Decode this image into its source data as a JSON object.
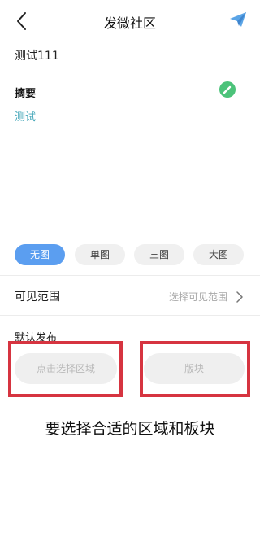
{
  "header": {
    "title": "发微社区",
    "back_icon": "chevron-left-icon",
    "send_icon": "paper-plane-icon",
    "send_color": "#5aa4e6"
  },
  "post": {
    "title": "测试111"
  },
  "summary": {
    "label": "摘要",
    "text": "测试",
    "edit_icon": "pencil-icon",
    "edit_color": "#4cc37a"
  },
  "image_options": {
    "items": [
      {
        "label": "无图",
        "selected": true
      },
      {
        "label": "单图",
        "selected": false
      },
      {
        "label": "三图",
        "selected": false
      },
      {
        "label": "大图",
        "selected": false
      }
    ],
    "active_color": "#5b9ef0"
  },
  "visibility": {
    "label": "可见范围",
    "value": "选择可见范围",
    "icon": "chevron-right-icon"
  },
  "default_publish": {
    "label": "默认发布",
    "region_placeholder": "点击选择区域",
    "separator": "—",
    "board_placeholder": "版块",
    "highlight_color": "#d63440"
  },
  "instruction": "要选择合适的区域和板块"
}
